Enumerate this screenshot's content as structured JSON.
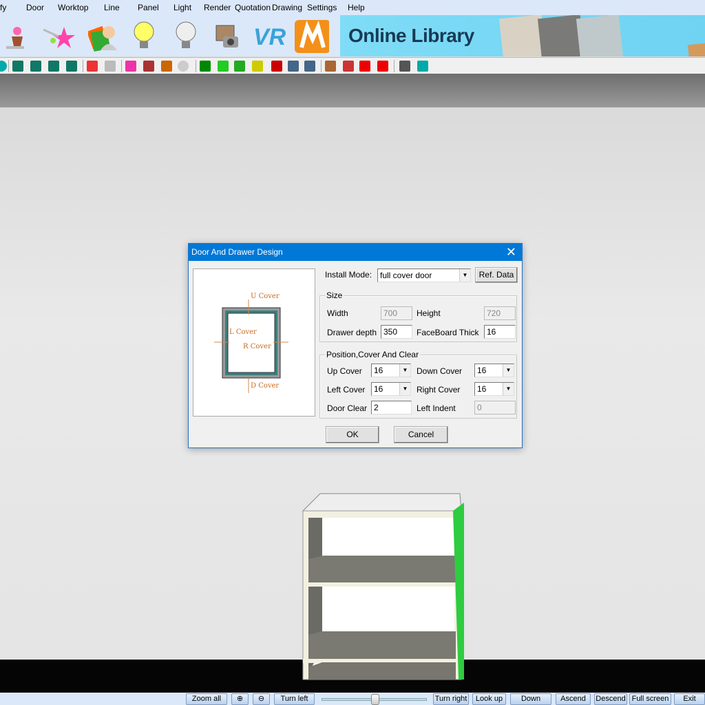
{
  "menu": [
    "fy",
    "Door",
    "Worktop",
    "Line",
    "Panel",
    "Light",
    "Render",
    "Quotation",
    "Drawing",
    "Settings",
    "Help"
  ],
  "big_icons": [
    "plant-icon",
    "stars-icon",
    "user-cards-icon",
    "light-on-icon",
    "light-off-icon",
    "photo-camera-icon",
    "vr-icon",
    "m-logo-icon"
  ],
  "banner": {
    "text": "Online Library"
  },
  "toolbar_icons": [
    "circle-icon",
    "cabinet-1-icon",
    "cabinet-2-icon",
    "cabinet-3-icon",
    "cabinet-4-icon",
    "colors-icon",
    "lamp-icon",
    "palette-play-icon",
    "path-play-icon",
    "layer-play-icon",
    "sphere-icon",
    "select-arrow-icon",
    "cube-icon",
    "wall-icon",
    "rect-select-icon",
    "delete-arrow-icon",
    "undo-icon",
    "redo-icon",
    "align-icon",
    "mirror-icon",
    "rotate-icon",
    "move-icon",
    "list-icon",
    "plan-icon"
  ],
  "dialog": {
    "title": "Door And Drawer Design",
    "preview": {
      "up": "U Cover",
      "left": "L Cover",
      "right": "R Cover",
      "down": "D Cover"
    },
    "install_mode_label": "Install Mode:",
    "install_mode_value": "full cover door",
    "ref_data": "Ref. Data",
    "size": {
      "legend": "Size",
      "width_label": "Width",
      "width": "700",
      "height_label": "Height",
      "height": "720",
      "depth_label": "Drawer depth",
      "depth": "350",
      "thick_label": "FaceBoard Thick",
      "thick": "16"
    },
    "position": {
      "legend": "Position,Cover And Clear",
      "up_label": "Up Cover",
      "up": "16",
      "down_label": "Down Cover",
      "down": "16",
      "left_label": "Left Cover",
      "left": "16",
      "right_label": "Right Cover",
      "right": "16",
      "clear_label": "Door Clear",
      "clear": "2",
      "indent_label": "Left Indent",
      "indent": "0"
    },
    "ok": "OK",
    "cancel": "Cancel"
  },
  "bottom": {
    "zoom_all": "Zoom all",
    "turn_left": "Turn left",
    "turn_right": "Turn right",
    "look_up": "Look up",
    "down": "Down",
    "ascend": "Ascend",
    "descend": "Descend",
    "full_screen": "Full screen",
    "exit": "Exit",
    "slider_value": 0.5
  },
  "colors": {
    "dialog_title": "#0078d7",
    "menubar": "#dbe8f9",
    "cabinet_edge": "#2ecc40"
  }
}
